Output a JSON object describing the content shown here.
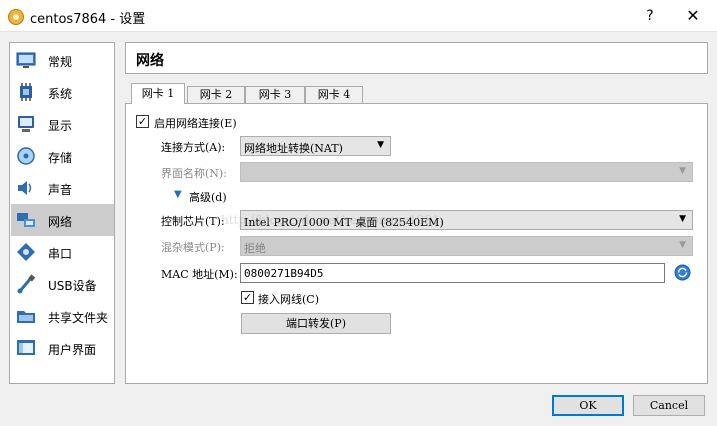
{
  "window": {
    "title": "centos7864 - 设置",
    "help_label": "?",
    "close_label": "✕"
  },
  "sidebar": {
    "items": [
      {
        "label": "常规",
        "icon": "general-icon"
      },
      {
        "label": "系统",
        "icon": "system-icon"
      },
      {
        "label": "显示",
        "icon": "display-icon"
      },
      {
        "label": "存储",
        "icon": "storage-icon"
      },
      {
        "label": "声音",
        "icon": "audio-icon"
      },
      {
        "label": "网络",
        "icon": "network-icon",
        "selected": true
      },
      {
        "label": "串口",
        "icon": "serial-port-icon"
      },
      {
        "label": "USB设备",
        "icon": "usb-icon"
      },
      {
        "label": "共享文件夹",
        "icon": "shared-folder-icon"
      },
      {
        "label": "用户界面",
        "icon": "user-interface-icon"
      }
    ]
  },
  "panel": {
    "title": "网络",
    "tabs": [
      {
        "label": "网卡 1",
        "active": true
      },
      {
        "label": "网卡 2"
      },
      {
        "label": "网卡 3"
      },
      {
        "label": "网卡 4"
      }
    ],
    "enable_adapter_label": "启用网络连接(E)",
    "attached_to_label": "连接方式(A):",
    "attached_to_value": "网络地址转换(NAT)",
    "name_label": "界面名称(N):",
    "name_value": "",
    "advanced_label": "高级(d)",
    "adapter_type_label": "控制芯片(T):",
    "adapter_type_value": "Intel PRO/1000 MT 桌面 (82540EM)",
    "promiscuous_label": "混杂模式(P):",
    "promiscuous_value": "拒绝",
    "mac_label": "MAC 地址(M):",
    "mac_value": "0800271B94D5",
    "cable_connected_label": "接入网线(C)",
    "port_forwarding_label": "端口转发(P)",
    "watermark": "http://blog.csdn.net/renyongge1981"
  },
  "footer": {
    "ok_label": "OK",
    "cancel_label": "Cancel"
  },
  "colors": {
    "selected_item": "#cccccc",
    "primary_border": "#0078d7",
    "disabled_field": "#cccccc"
  }
}
